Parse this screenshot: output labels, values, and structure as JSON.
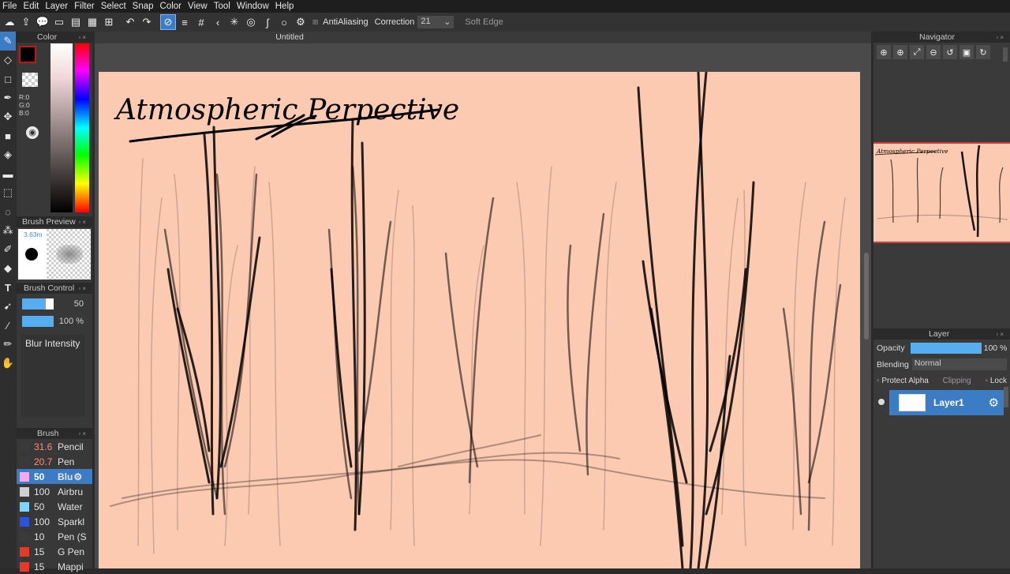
{
  "menu": [
    "File",
    "Edit",
    "Layer",
    "Filter",
    "Select",
    "Snap",
    "Color",
    "View",
    "Tool",
    "Window",
    "Help"
  ],
  "toolbar": {
    "antialiasing": "AntiAliasing",
    "correction_label": "Correction",
    "correction_value": "21",
    "soft_edge": "Soft Edge"
  },
  "color_panel": {
    "title": "Color",
    "r": "R:0",
    "g": "G:0",
    "b": "B:0",
    "fg_color": "#000000"
  },
  "brush_preview": {
    "title": "Brush Preview",
    "size": "3.63m"
  },
  "brush_control": {
    "title": "Brush Control",
    "size_value": "50",
    "opacity_value": "100 %",
    "mode": "Blur Intensity"
  },
  "brush_panel": {
    "title": "Brush",
    "items": [
      {
        "num": "31.6",
        "name": "Pencil",
        "color": "#3a3a3a",
        "num_color": "#ff8a7a"
      },
      {
        "num": "20.7",
        "name": "Pen",
        "color": "#3a3a3a",
        "num_color": "#ff8a7a"
      },
      {
        "num": "50",
        "name": "Blu",
        "color": "#f7a8ea",
        "num_color": "#ffffff"
      },
      {
        "num": "100",
        "name": "Airbru",
        "color": "#cfcfcf",
        "num_color": "#e4e4e4"
      },
      {
        "num": "50",
        "name": "Water",
        "color": "#7ed6ff",
        "num_color": "#e4e4e4"
      },
      {
        "num": "100",
        "name": "Sparkl",
        "color": "#2a54e0",
        "num_color": "#e4e4e4"
      },
      {
        "num": "10",
        "name": "Pen (S",
        "color": "#3a3a3a",
        "num_color": "#e4e4e4"
      },
      {
        "num": "15",
        "name": "G Pen",
        "color": "#e53a2a",
        "num_color": "#e4e4e4"
      },
      {
        "num": "15",
        "name": "Mappi",
        "color": "#e53a2a",
        "num_color": "#e4e4e4"
      }
    ]
  },
  "document": {
    "title": "Untitled",
    "heading": "Atmospheric Perpective"
  },
  "navigator": {
    "title": "Navigator"
  },
  "layer_panel": {
    "title": "Layer",
    "opacity_label": "Opacity",
    "opacity_value": "100 %",
    "blending_label": "Blending",
    "blending_value": "Normal",
    "protect_alpha": "Protect Alpha",
    "clipping": "Clipping",
    "lock": "Lock",
    "layer_name": "Layer1"
  }
}
